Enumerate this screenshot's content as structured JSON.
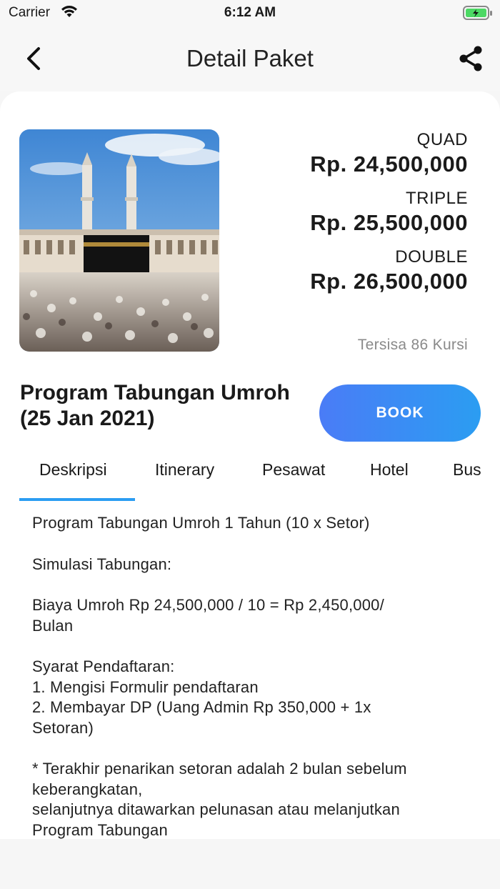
{
  "status_bar": {
    "carrier": "Carrier",
    "time": "6:12 AM"
  },
  "nav": {
    "title": "Detail Paket",
    "back_icon": "chevron-left-icon",
    "share_icon": "share-icon"
  },
  "package": {
    "image_alt": "Kaaba Mecca photo",
    "prices": [
      {
        "room": "QUAD",
        "price": "Rp. 24,500,000"
      },
      {
        "room": "TRIPLE",
        "price": "Rp. 25,500,000"
      },
      {
        "room": "DOUBLE",
        "price": "Rp. 26,500,000"
      }
    ],
    "seats_left": "Tersisa 86 Kursi",
    "title_line1": "Program Tabungan Umroh",
    "title_line2": "(25 Jan 2021)",
    "book_label": "BOOK"
  },
  "tabs": [
    {
      "label": "Deskripsi",
      "active": true
    },
    {
      "label": "Itinerary",
      "active": false
    },
    {
      "label": "Pesawat",
      "active": false
    },
    {
      "label": "Hotel",
      "active": false
    },
    {
      "label": "Bus",
      "active": false
    }
  ],
  "description": {
    "line1": "Program Tabungan Umroh 1 Tahun (10 x Setor)",
    "line2": "Simulasi Tabungan:",
    "line3a": "Biaya Umroh Rp 24,500,000 / 10 = Rp 2,450,000/",
    "line3b": "Bulan",
    "line4": "Syarat Pendaftaran:",
    "line5": "1. Mengisi Formulir pendaftaran",
    "line6a": "2. Membayar DP (Uang Admin Rp 350,000 + 1x",
    "line6b": "Setoran)",
    "line7a": "* Terakhir penarikan setoran adalah 2 bulan sebelum",
    "line7b": "keberangkatan,",
    "line8": "selanjutnya ditawarkan pelunasan atau melanjutkan",
    "line9": "Program Tabungan"
  },
  "colors": {
    "accent": "#2b9df2",
    "button_gradient_start": "#4a7cf6",
    "muted_text": "#8a8a8a",
    "battery_green": "#4cd964"
  }
}
